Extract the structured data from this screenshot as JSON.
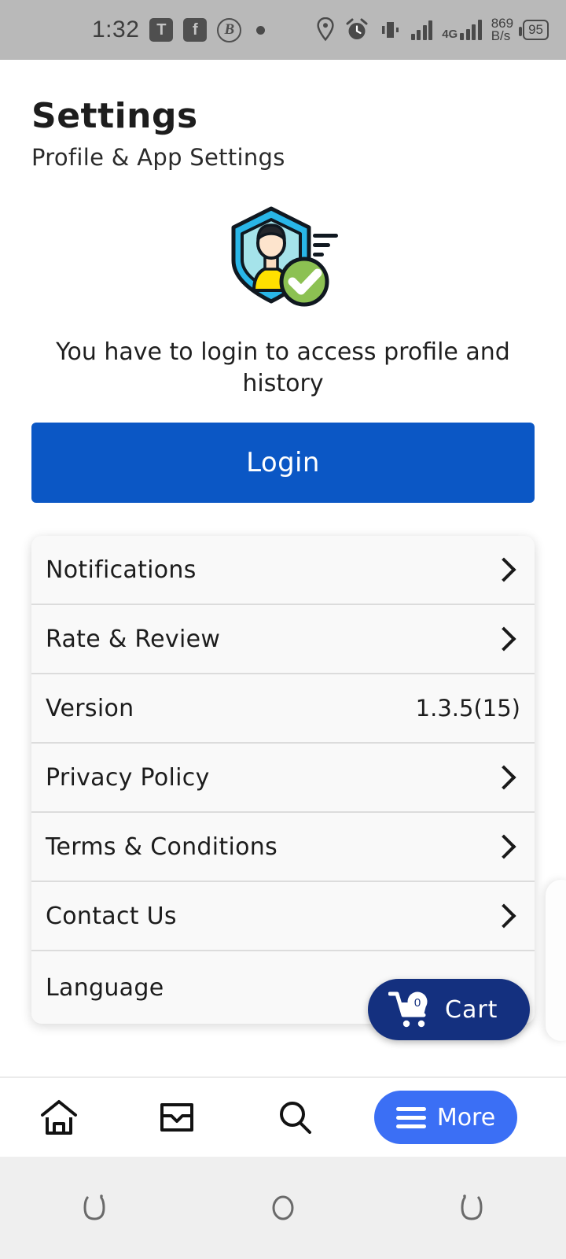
{
  "status_bar": {
    "time": "1:32",
    "icons_left": [
      "t-badge-icon",
      "facebook-icon",
      "b-circle-icon",
      "dot-icon"
    ],
    "t_badge": "T",
    "fb_badge": "f",
    "b_badge": "B",
    "icons_right": [
      "location-pin-icon",
      "alarm-clock-icon",
      "vibrate-icon",
      "signal-bars-icon",
      "mobile-data-icon"
    ],
    "network_type": "4G",
    "data_speed": "869",
    "data_speed_unit": "B/s",
    "battery_level": "95"
  },
  "header": {
    "title": "Settings",
    "subtitle": "Profile & App Settings"
  },
  "illustration": {
    "name": "shield-profile-verified-illustration",
    "shield_color": "#29b6e8",
    "shield_fill": "#a5e3ea",
    "shirt_color": "#ffe000",
    "check_badge_color": "#8cc152"
  },
  "login": {
    "message": "You have to login to access profile and history",
    "button_label": "Login",
    "button_color": "#0b57c5"
  },
  "settings_list": [
    {
      "label": "Notifications",
      "type": "chevron",
      "value": ""
    },
    {
      "label": "Rate & Review",
      "type": "chevron",
      "value": ""
    },
    {
      "label": "Version",
      "type": "value",
      "value": "1.3.5(15)"
    },
    {
      "label": "Privacy Policy",
      "type": "chevron",
      "value": ""
    },
    {
      "label": "Terms & Conditions",
      "type": "chevron",
      "value": ""
    },
    {
      "label": "Contact Us",
      "type": "chevron",
      "value": ""
    },
    {
      "label": "Language",
      "type": "plain",
      "value": ""
    }
  ],
  "cart_fab": {
    "label": "Cart",
    "badge_count": "0",
    "color": "#14307f"
  },
  "bottom_nav": {
    "items": [
      "home-icon",
      "inbox-icon",
      "search-icon"
    ],
    "more_label": "More",
    "more_color": "#3b6ff5"
  },
  "android_nav": {
    "items": [
      "recents-icon",
      "home-circle-icon",
      "back-icon"
    ]
  }
}
